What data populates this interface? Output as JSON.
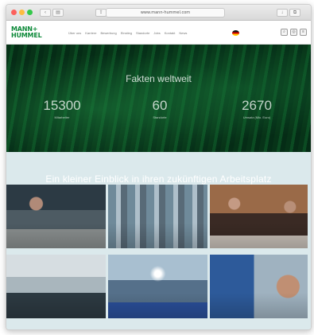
{
  "browser": {
    "url": "www.mann-hummel.com"
  },
  "header": {
    "logo_line1": "MANN+",
    "logo_line2": "HUMMEL",
    "nav_items": [
      "Über uns",
      "Karriere",
      "Bewerbung",
      "Einstieg",
      "Standorte",
      "Jobs",
      "Kontakt",
      "News"
    ]
  },
  "hero": {
    "title": "Fakten weltweit",
    "stats": [
      {
        "value": "15300",
        "label": "Mitarbeiter"
      },
      {
        "value": "60",
        "label": "Standorte"
      },
      {
        "value": "2670",
        "label": "Umsatz (Mio. Euro)"
      }
    ]
  },
  "section": {
    "title": "Ein kleiner Einblick in ihren zukünftigen Arbeitsplatz"
  },
  "colors": {
    "brand_green": "#0e8a3a",
    "hero_bg": "#0b4320",
    "section_bg": "#dbe9ec"
  }
}
